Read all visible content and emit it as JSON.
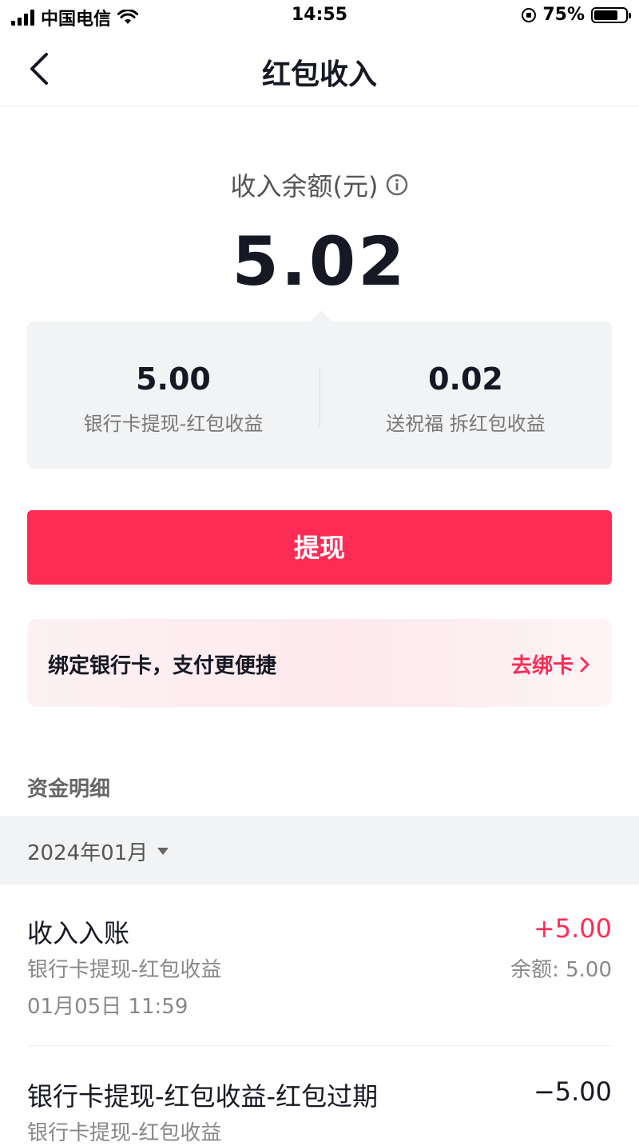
{
  "status_bar": {
    "carrier": "中国电信",
    "time": "14:55",
    "battery_text": "75%",
    "battery_level": 0.75
  },
  "nav": {
    "title": "红包收入"
  },
  "balance": {
    "label": "收入余额(元)",
    "amount": "5.02"
  },
  "breakdown": [
    {
      "value": "5.00",
      "label": "银行卡提现-红包收益"
    },
    {
      "value": "0.02",
      "label": "送祝福 拆红包收益"
    }
  ],
  "withdraw_label": "提现",
  "bind_card": {
    "text": "绑定银行卡，支付更便捷",
    "link": "去绑卡"
  },
  "details": {
    "title": "资金明细",
    "month": "2024年01月"
  },
  "transactions": [
    {
      "title": "收入入账",
      "amount": "+5.00",
      "subtitle": "银行卡提现-红包收益",
      "balance": "余额: 5.00",
      "time": "01月05日 11:59"
    },
    {
      "title": "银行卡提现-红包收益-红包过期",
      "amount": "−5.00",
      "subtitle": "银行卡提现-红包收益"
    }
  ],
  "colors": {
    "accent": "#fe2c55",
    "card_bg": "#f2f3f4"
  }
}
